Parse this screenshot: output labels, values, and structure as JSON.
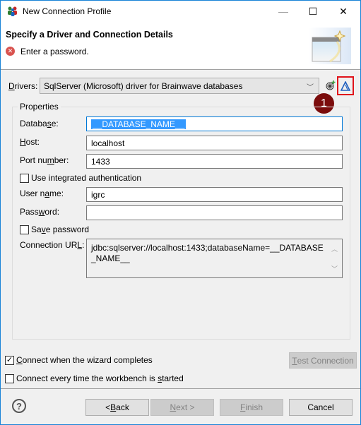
{
  "window": {
    "title": "New Connection Profile",
    "minimize_glyph": "—",
    "maximize_glyph": "☐",
    "close_glyph": "✕"
  },
  "header": {
    "title": "Specify a Driver and Connection Details",
    "error_icon": "error-icon",
    "message": "Enter a password."
  },
  "drivers": {
    "label_mnemonic": "D",
    "label_rest": "rivers:",
    "selected": "SqlServer (Microsoft) driver for Brainwave databases",
    "new_driver_icon": "new-driver-icon",
    "edit_driver_icon": "edit-driver-icon",
    "callout_number": "1"
  },
  "properties": {
    "legend": "Properties",
    "database": {
      "label_pre": "Data",
      "label_ba": "ba",
      "label_mn": "s",
      "label_post": "e:",
      "value": "__DATABASE_NAME__"
    },
    "host": {
      "label_mn": "H",
      "label_post": "ost:",
      "value": "localhost"
    },
    "port": {
      "label_pre": "Port nu",
      "label_mn": "m",
      "label_post": "ber:",
      "value": "1433"
    },
    "integrated_auth": {
      "label": "Use integrated authentication",
      "checked": false
    },
    "user": {
      "label_pre": "User n",
      "label_mn": "a",
      "label_post": "me:",
      "value": "igrc"
    },
    "password": {
      "label_pre": "Pass",
      "label_mn": "w",
      "label_post": "ord:",
      "value": ""
    },
    "save_password": {
      "label_pre": "Sa",
      "label_mn": "v",
      "label_post": "e password",
      "checked": false
    },
    "url": {
      "label_pre": "Connection UR",
      "label_mn": "L",
      "label_post": ":",
      "value": "jdbc:sqlserver://localhost:1433;databaseName=__DATABASE_NAME__"
    }
  },
  "options": {
    "connect_on_finish": {
      "label_mn": "C",
      "label_post": "onnect when the wizard completes",
      "checked": true
    },
    "connect_on_startup": {
      "label_pre": "Connect every time the workbench is ",
      "label_mn": "s",
      "label_post": "tarted",
      "checked": false
    },
    "test_connection": {
      "label_mn": "T",
      "label_post": "est Connection",
      "enabled": false
    }
  },
  "footer": {
    "help_glyph": "?",
    "back": {
      "pre": "< ",
      "mn": "B",
      "post": "ack",
      "enabled": true
    },
    "next": {
      "mn": "N",
      "post": "ext >",
      "enabled": false
    },
    "finish": {
      "mn": "F",
      "post": "inish",
      "enabled": false
    },
    "cancel": {
      "label": "Cancel",
      "enabled": true
    }
  }
}
